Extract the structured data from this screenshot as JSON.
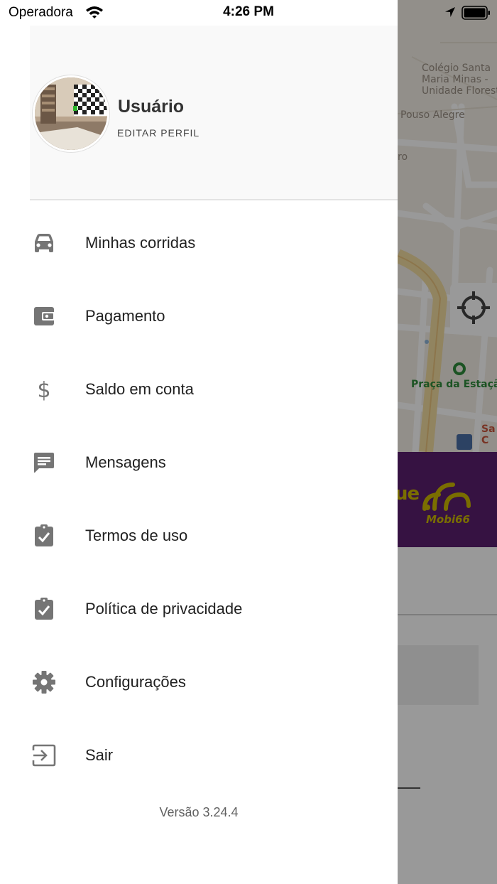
{
  "status_bar": {
    "carrier": "Operadora",
    "time": "4:26 PM",
    "icons": [
      "wifi-icon",
      "location-arrow-icon",
      "battery-icon"
    ]
  },
  "background": {
    "map_labels": {
      "school": "Colégio Santa\nMaria Minas -\nUnidade Floresta",
      "street_pouso": "Pouso Alegre",
      "street_ro": "ro",
      "praca": "Praça da Estaçã",
      "sa": "Sa\nC"
    },
    "banner": {
      "text": "ue",
      "logo_text": "Mobi66",
      "color": "#5b1f6f",
      "accent": "#cbb800"
    }
  },
  "drawer": {
    "header": {
      "user_name": "Usuário",
      "edit_profile": "EDITAR PERFIL"
    },
    "menu": [
      {
        "label": "Minhas corridas",
        "icon": "car-icon"
      },
      {
        "label": "Pagamento",
        "icon": "wallet-icon"
      },
      {
        "label": "Saldo em conta",
        "icon": "dollar-icon"
      },
      {
        "label": "Mensagens",
        "icon": "message-icon"
      },
      {
        "label": "Termos de uso",
        "icon": "clipboard-check-icon"
      },
      {
        "label": "Política de privacidade",
        "icon": "clipboard-check-icon"
      },
      {
        "label": "Configurações",
        "icon": "gear-icon"
      },
      {
        "label": "Sair",
        "icon": "exit-icon"
      }
    ],
    "version": "Versão 3.24.4"
  },
  "colors": {
    "icon_gray": "#757575",
    "dim_overlay": "rgba(0,0,0,0.40)"
  }
}
